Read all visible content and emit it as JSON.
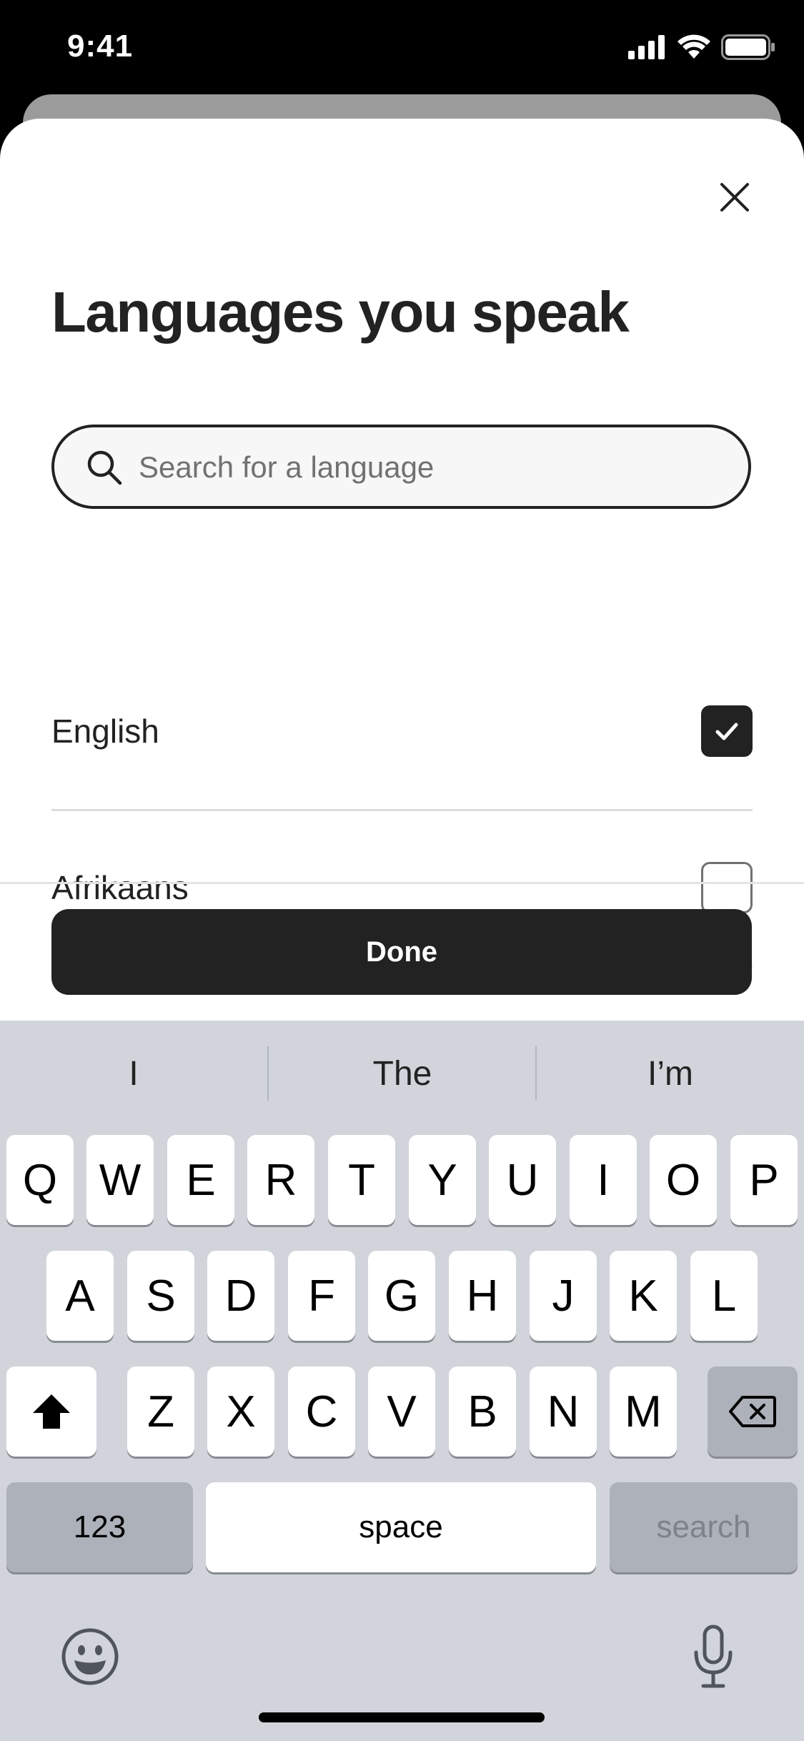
{
  "status_bar": {
    "time": "9:41"
  },
  "sheet": {
    "title": "Languages you speak",
    "search": {
      "placeholder": "Search for a language",
      "value": ""
    },
    "languages": [
      {
        "label": "English",
        "checked": true
      },
      {
        "label": "Afrikaans",
        "checked": false
      }
    ],
    "done_label": "Done"
  },
  "keyboard": {
    "suggestions": [
      "I",
      "The",
      "I’m"
    ],
    "row1": [
      "Q",
      "W",
      "E",
      "R",
      "T",
      "Y",
      "U",
      "I",
      "O",
      "P"
    ],
    "row2": [
      "A",
      "S",
      "D",
      "F",
      "G",
      "H",
      "J",
      "K",
      "L"
    ],
    "row3": [
      "Z",
      "X",
      "C",
      "V",
      "B",
      "N",
      "M"
    ],
    "numbers_label": "123",
    "space_label": "space",
    "search_label": "search"
  },
  "colors": {
    "text_primary": "#222222",
    "checkbox_checked": "#222222",
    "keyboard_bg": "#d1d4da"
  }
}
